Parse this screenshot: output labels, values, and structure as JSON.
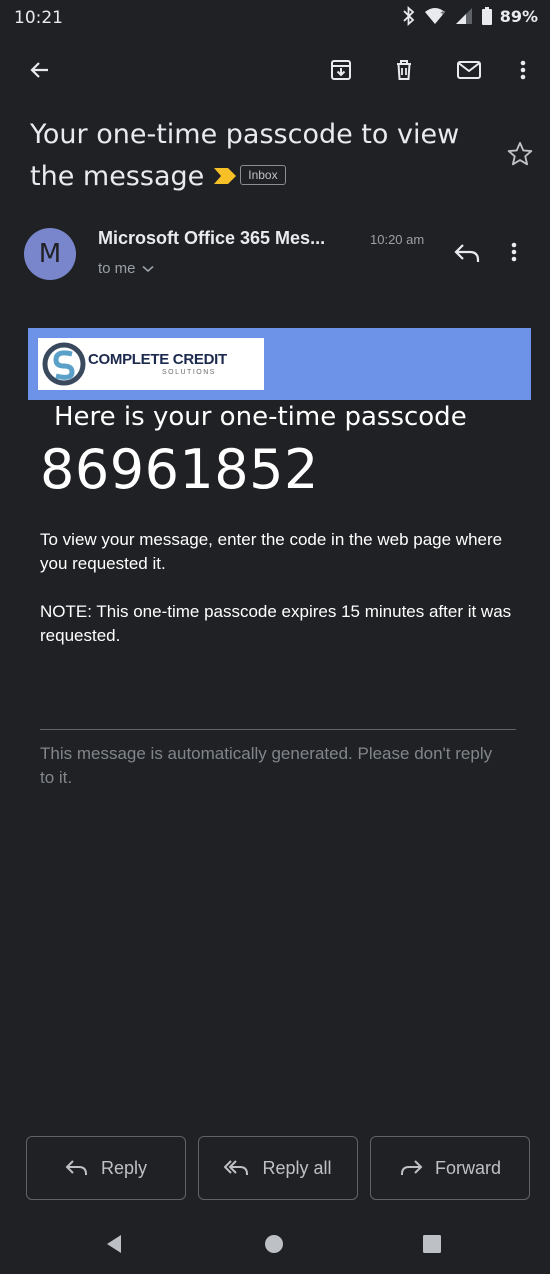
{
  "status_bar": {
    "time": "10:21",
    "battery": "89%"
  },
  "email": {
    "subject": "Your one-time passcode to view the message",
    "label": "Inbox",
    "sender": {
      "initial": "M",
      "name": "Microsoft Office 365 Mes...",
      "time": "10:20 am",
      "recipient": "to me"
    },
    "body": {
      "logo_main": "COMPLETE CREDIT",
      "logo_sub": "SOLUTIONS",
      "heading": "Here is your one-time passcode",
      "passcode": "86961852",
      "instruction": "To view your message, enter the code in the web page where you requested it.",
      "note": "NOTE: This one-time passcode expires 15 minutes after it was requested.",
      "footer": "This message is automatically generated. Please don't reply to it."
    }
  },
  "actions": {
    "reply": "Reply",
    "reply_all": "Reply all",
    "forward": "Forward"
  },
  "colors": {
    "background": "#202124",
    "banner": "#6d93e8",
    "avatar": "#7986cb",
    "importance_marker": "#f6c026"
  }
}
